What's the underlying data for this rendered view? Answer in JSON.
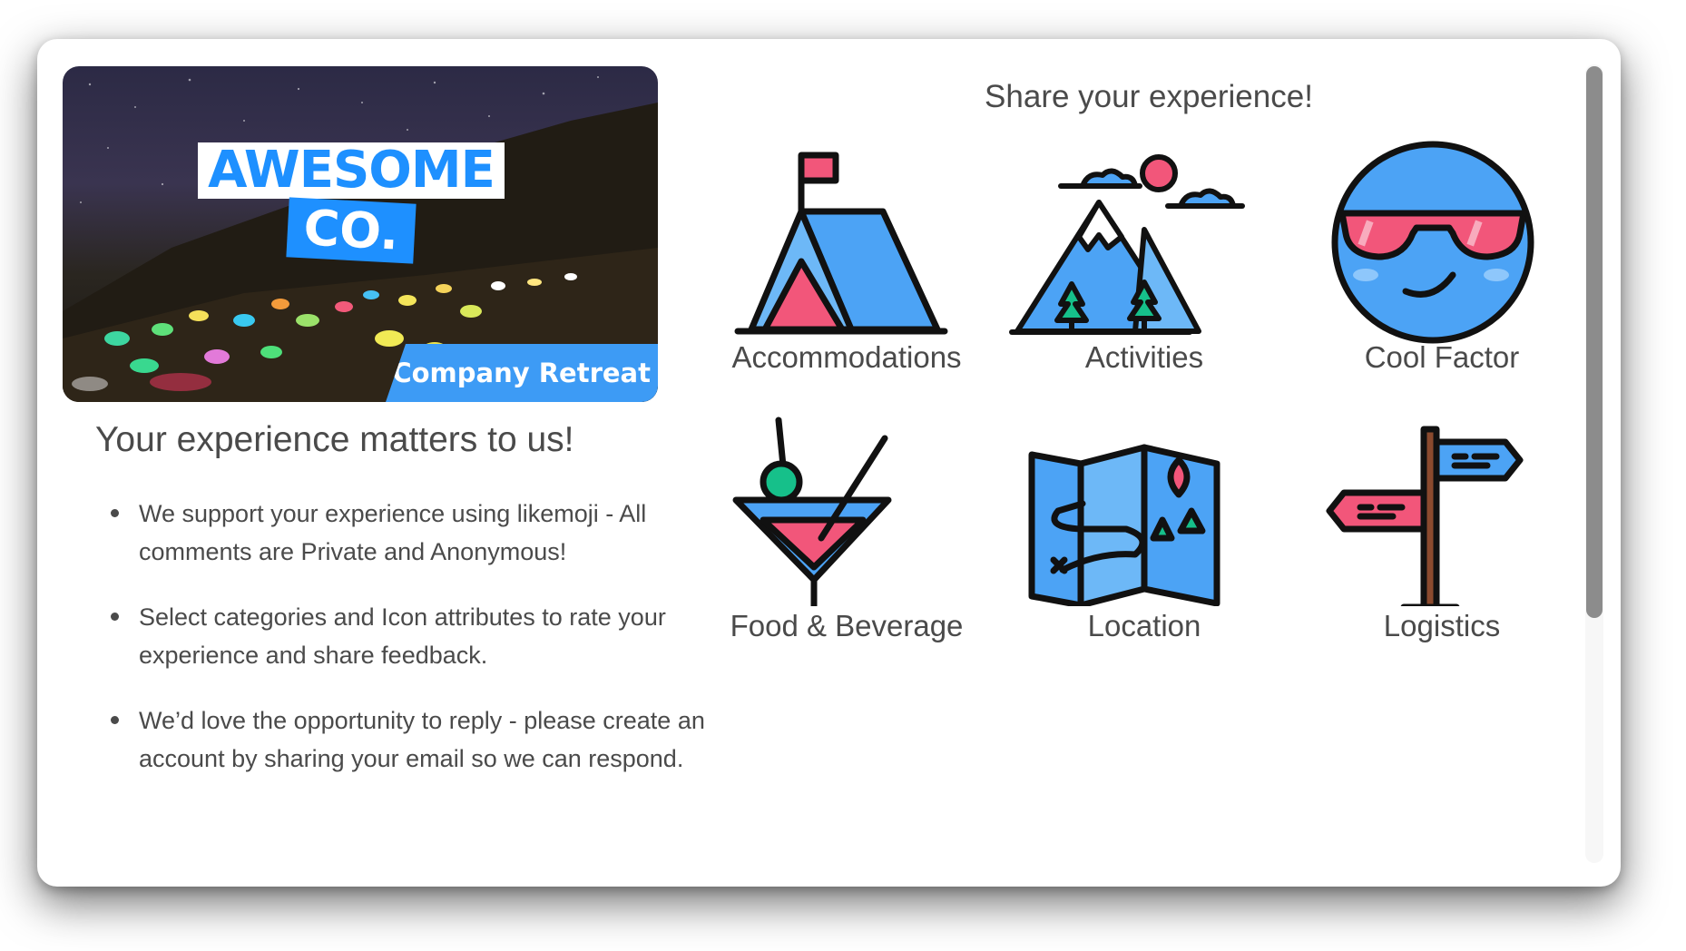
{
  "hero": {
    "logo_line1": "AWESOME",
    "logo_line2": "CO.",
    "tag": "Company Retreat"
  },
  "left": {
    "headline": "Your experience matters to us!",
    "bullets": [
      "We support your experience using likemoji - All comments are Private and Anonymous!",
      "Select categories and Icon attributes to rate your experience and share feedback.",
      "We’d love the opportunity to reply - please create an account by sharing your email so we can respond."
    ]
  },
  "right": {
    "title": "Share your experience!",
    "categories": [
      {
        "label": "Accommodations",
        "icon": "tent-icon"
      },
      {
        "label": "Activities",
        "icon": "mountain-icon"
      },
      {
        "label": "Cool Factor",
        "icon": "sunglasses-emoji-icon"
      },
      {
        "label": "Food & Beverage",
        "icon": "cocktail-icon"
      },
      {
        "label": "Location",
        "icon": "map-icon"
      },
      {
        "label": "Logistics",
        "icon": "signpost-icon"
      }
    ]
  },
  "colors": {
    "accent_blue": "#4ca3f5",
    "icon_pink": "#f2567a",
    "icon_green": "#16c08a",
    "text_gray": "#4a4a4a"
  }
}
